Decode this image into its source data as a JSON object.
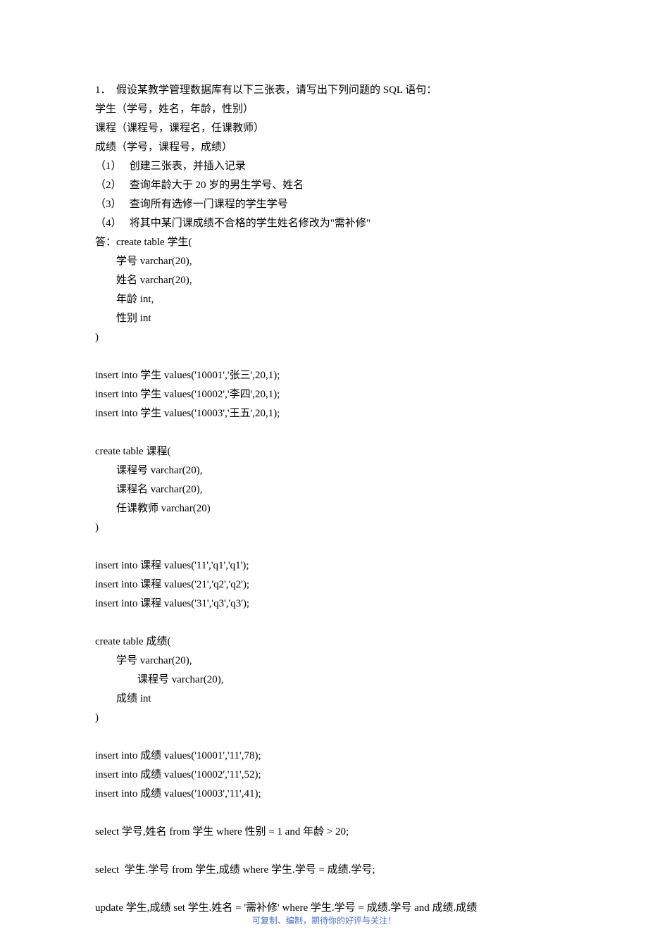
{
  "lines": {
    "q_intro": "1．  假设某教学管理数据库有以下三张表，请写出下列问题的 SQL 语句：",
    "q_t1": "学生（学号，姓名，年龄，性别）",
    "q_t2": "课程（课程号，课程名，任课教师）",
    "q_t3": "成绩（学号，课程号，成绩）",
    "q_sub1": "（1）   创建三张表，并插入记录",
    "q_sub2": "（2）   查询年龄大于 20 岁的男生学号、姓名",
    "q_sub3": "（3）   查询所有选修一门课程的学生学号",
    "q_sub4": "（4）   将其中某门课成绩不合格的学生姓名修改为\"需补修\"",
    "a_head": "答：create table 学生(",
    "a_s_c1": "学号 varchar(20),",
    "a_s_c2": "姓名 varchar(20),",
    "a_s_c3": "年龄 int,",
    "a_s_c4": "性别 int",
    "close_paren": ")",
    "ins_s1": "insert into 学生 values('10001','张三',20,1);",
    "ins_s2": "insert into 学生 values('10002','李四',20,1);",
    "ins_s3": "insert into 学生 values('10003','王五',20,1);",
    "ct_c": "create table 课程(",
    "c_c1": "课程号 varchar(20),",
    "c_c2": "课程名 varchar(20),",
    "c_c3": "任课教师 varchar(20)",
    "ins_c1": "insert into 课程 values('11','q1','q1');",
    "ins_c2": "insert into 课程 values('21','q2','q2');",
    "ins_c3": "insert into 课程 values('31','q3','q3');",
    "ct_g": "create table 成绩(",
    "g_c1": "学号 varchar(20),",
    "g_c2": "课程号 varchar(20),",
    "g_c3": "成绩 int",
    "ins_g1": "insert into 成绩 values('10001','11',78);",
    "ins_g2": "insert into 成绩 values('10002','11',52);",
    "ins_g3": "insert into 成绩 values('10003','11',41);",
    "sel1": "select 学号,姓名 from 学生 where 性别 = 1 and 年龄 > 20;",
    "sel2": "select  学生.学号 from 学生,成绩 where 学生.学号 = 成绩.学号;",
    "upd1": "update 学生,成绩 set 学生.姓名 = '需补修' where 学生.学号 = 成绩.学号 and 成绩.成绩"
  },
  "footer": "可复制、编制，期待你的好评与关注！"
}
